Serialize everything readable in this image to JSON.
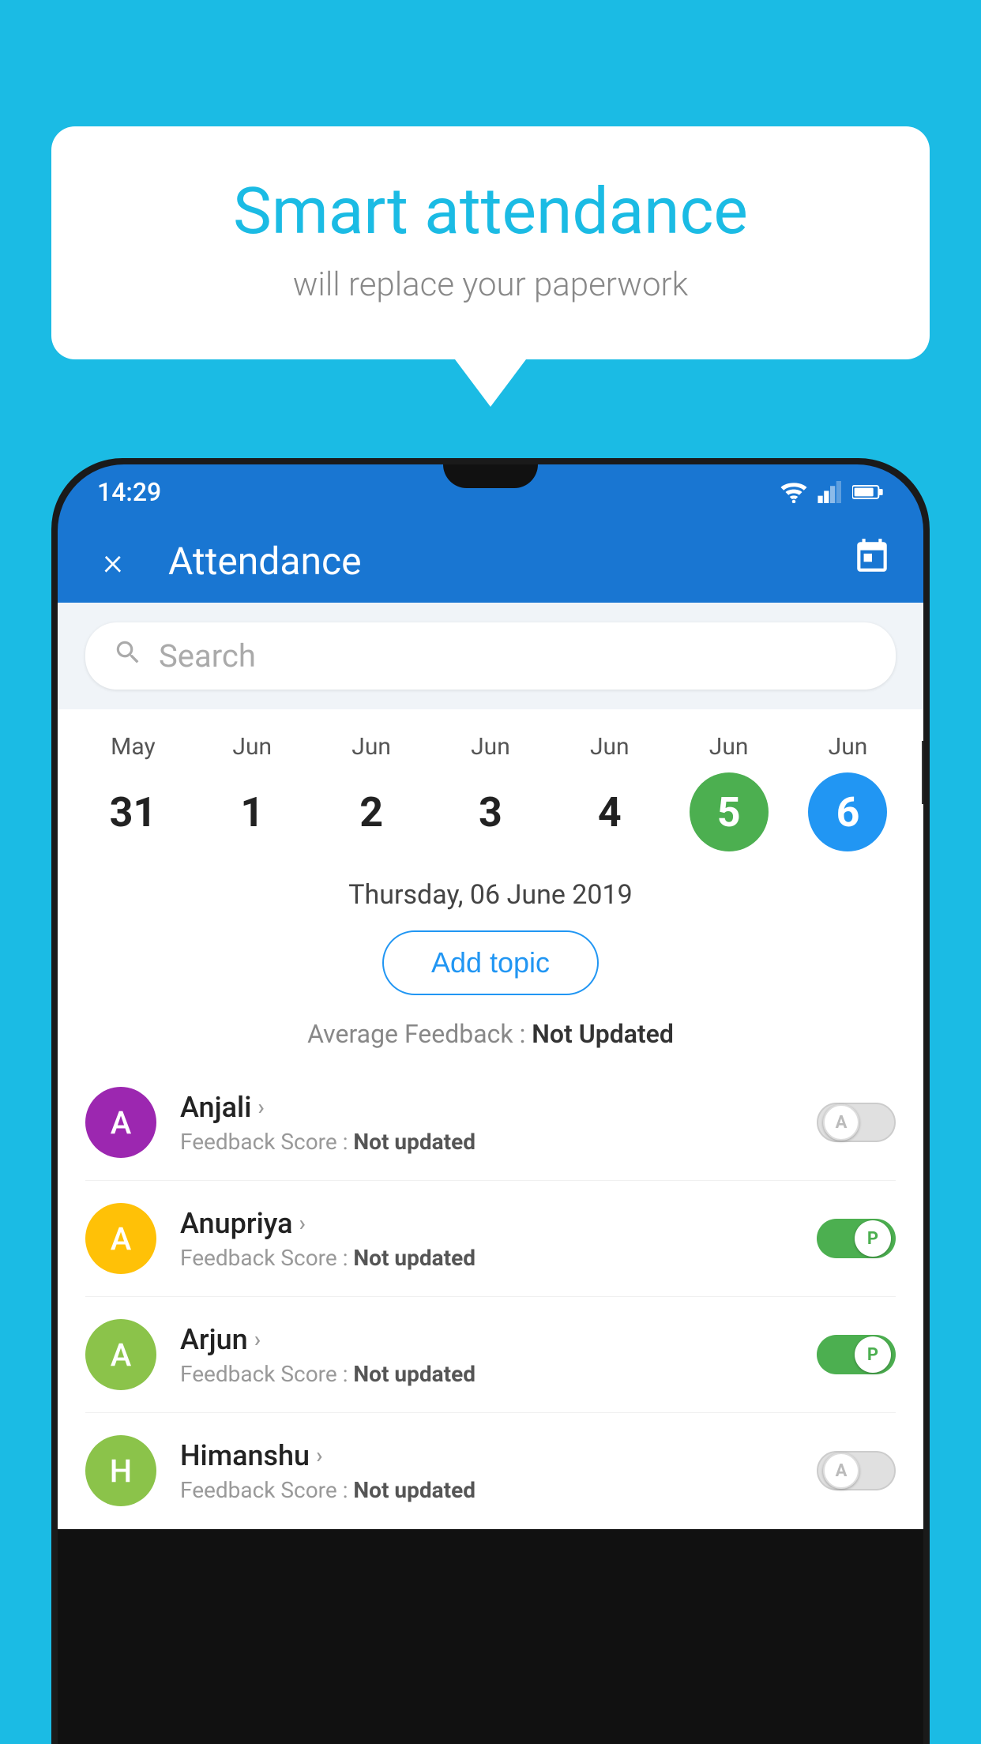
{
  "page": {
    "background_color": "#1BBBE4"
  },
  "speech_bubble": {
    "title": "Smart attendance",
    "subtitle": "will replace your paperwork"
  },
  "status_bar": {
    "time": "14:29"
  },
  "app_bar": {
    "title": "Attendance",
    "close_label": "×",
    "calendar_icon": "📅"
  },
  "search": {
    "placeholder": "Search"
  },
  "calendar": {
    "days": [
      {
        "month": "May",
        "date": "31",
        "style": "normal"
      },
      {
        "month": "Jun",
        "date": "1",
        "style": "normal"
      },
      {
        "month": "Jun",
        "date": "2",
        "style": "normal"
      },
      {
        "month": "Jun",
        "date": "3",
        "style": "normal"
      },
      {
        "month": "Jun",
        "date": "4",
        "style": "normal"
      },
      {
        "month": "Jun",
        "date": "5",
        "style": "green"
      },
      {
        "month": "Jun",
        "date": "6",
        "style": "blue"
      }
    ]
  },
  "selected_date_label": "Thursday, 06 June 2019",
  "add_topic_label": "Add topic",
  "avg_feedback_label": "Average Feedback :",
  "avg_feedback_value": "Not Updated",
  "students": [
    {
      "name": "Anjali",
      "avatar_letter": "A",
      "avatar_color": "#9C27B0",
      "feedback_label": "Feedback Score :",
      "feedback_value": "Not updated",
      "toggle": "off",
      "toggle_letter": "A"
    },
    {
      "name": "Anupriya",
      "avatar_letter": "A",
      "avatar_color": "#FFC107",
      "feedback_label": "Feedback Score :",
      "feedback_value": "Not updated",
      "toggle": "on",
      "toggle_letter": "P"
    },
    {
      "name": "Arjun",
      "avatar_letter": "A",
      "avatar_color": "#8BC34A",
      "feedback_label": "Feedback Score :",
      "feedback_value": "Not updated",
      "toggle": "on",
      "toggle_letter": "P"
    },
    {
      "name": "Himanshu",
      "avatar_letter": "H",
      "avatar_color": "#8BC34A",
      "feedback_label": "Feedback Score :",
      "feedback_value": "Not updated",
      "toggle": "off",
      "toggle_letter": "A"
    }
  ]
}
